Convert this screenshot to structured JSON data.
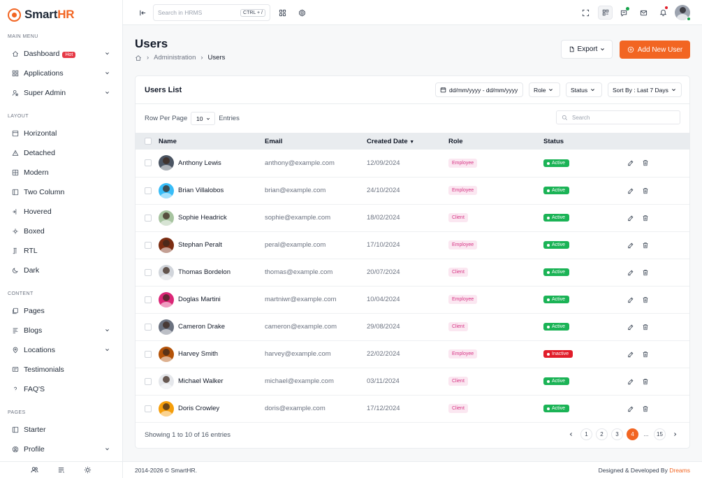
{
  "app": {
    "logo_prefix": "Smart",
    "logo_suffix": "HR",
    "brand_color": "#f26522"
  },
  "sidebar": {
    "sections": [
      {
        "title": "MAIN MENU",
        "items": [
          {
            "label": "Dashboard",
            "icon": "home-icon",
            "badge": "Hot",
            "chevron": true
          },
          {
            "label": "Applications",
            "icon": "grid-icon",
            "chevron": true
          },
          {
            "label": "Super Admin",
            "icon": "user-star-icon",
            "chevron": true
          }
        ]
      },
      {
        "title": "LAYOUT",
        "items": [
          {
            "label": "Horizontal",
            "icon": "layout-rows-icon"
          },
          {
            "label": "Detached",
            "icon": "triangle-icon"
          },
          {
            "label": "Modern",
            "icon": "grid-square-icon"
          },
          {
            "label": "Two Column",
            "icon": "columns-icon"
          },
          {
            "label": "Hovered",
            "icon": "hover-icon"
          },
          {
            "label": "Boxed",
            "icon": "box-icon"
          },
          {
            "label": "RTL",
            "icon": "rtl-icon"
          },
          {
            "label": "Dark",
            "icon": "moon-icon"
          }
        ]
      },
      {
        "title": "CONTENT",
        "items": [
          {
            "label": "Pages",
            "icon": "pages-icon"
          },
          {
            "label": "Blogs",
            "icon": "blog-icon",
            "chevron": true
          },
          {
            "label": "Locations",
            "icon": "location-icon",
            "chevron": true
          },
          {
            "label": "Testimonials",
            "icon": "message-icon"
          },
          {
            "label": "FAQ'S",
            "icon": "question-icon"
          }
        ]
      },
      {
        "title": "PAGES",
        "items": [
          {
            "label": "Starter",
            "icon": "starter-icon"
          },
          {
            "label": "Profile",
            "icon": "profile-icon",
            "chevron": true
          }
        ]
      }
    ]
  },
  "header": {
    "search_placeholder": "Search in HRMS",
    "shortcut": "CTRL + /"
  },
  "page": {
    "title": "Users",
    "breadcrumb": [
      "Administration",
      "Users"
    ],
    "export_label": "Export",
    "add_label": "Add New User"
  },
  "card": {
    "title": "Users List",
    "date_range": "dd/mm/yyyy - dd/mm/yyyy",
    "role_filter": "Role",
    "status_filter": "Status",
    "sort_label": "Sort By : Last 7 Days",
    "rows_label": "Row Per Page",
    "rows_value": "10",
    "entries_label": "Entries",
    "search_placeholder": "Search",
    "columns": [
      "Name",
      "Email",
      "Created Date",
      "Role",
      "Status"
    ],
    "rows": [
      {
        "name": "Anthony Lewis",
        "email": "anthony@example.com",
        "date": "12/09/2024",
        "role": "Employee",
        "status": "Active",
        "avatar_color": "#4b5563"
      },
      {
        "name": "Brian Villalobos",
        "email": "brian@example.com",
        "date": "24/10/2024",
        "role": "Employee",
        "status": "Active",
        "avatar_color": "#38bdf8"
      },
      {
        "name": "Sophie Headrick",
        "email": "sophie@example.com",
        "date": "18/02/2024",
        "role": "Client",
        "status": "Active",
        "avatar_color": "#a7c4a0"
      },
      {
        "name": "Stephan Peralt",
        "email": "peral@example.com",
        "date": "17/10/2024",
        "role": "Employee",
        "status": "Active",
        "avatar_color": "#7c2d12"
      },
      {
        "name": "Thomas Bordelon",
        "email": "thomas@example.com",
        "date": "20/07/2024",
        "role": "Client",
        "status": "Active",
        "avatar_color": "#d1d5db"
      },
      {
        "name": "Doglas Martini",
        "email": "martniwr@example.com",
        "date": "10/04/2024",
        "role": "Employee",
        "status": "Active",
        "avatar_color": "#db2777"
      },
      {
        "name": "Cameron Drake",
        "email": "cameron@example.com",
        "date": "29/08/2024",
        "role": "Client",
        "status": "Active",
        "avatar_color": "#6b7280"
      },
      {
        "name": "Harvey Smith",
        "email": "harvey@example.com",
        "date": "22/02/2024",
        "role": "Employee",
        "status": "Inactive",
        "avatar_color": "#b45309"
      },
      {
        "name": "Michael Walker",
        "email": "michael@example.com",
        "date": "03/11/2024",
        "role": "Client",
        "status": "Active",
        "avatar_color": "#e5e7eb"
      },
      {
        "name": "Doris Crowley",
        "email": "doris@example.com",
        "date": "17/12/2024",
        "role": "Client",
        "status": "Active",
        "avatar_color": "#f59e0b"
      }
    ],
    "showing": "Showing 1 to 10 of 16 entries",
    "pages": [
      "1",
      "2",
      "3",
      "4",
      "...",
      "15"
    ],
    "active_page": "4"
  },
  "footer": {
    "copyright": "2014-2026 © SmartHR.",
    "designed": "Designed & Developed By",
    "brand": "Dreams"
  }
}
